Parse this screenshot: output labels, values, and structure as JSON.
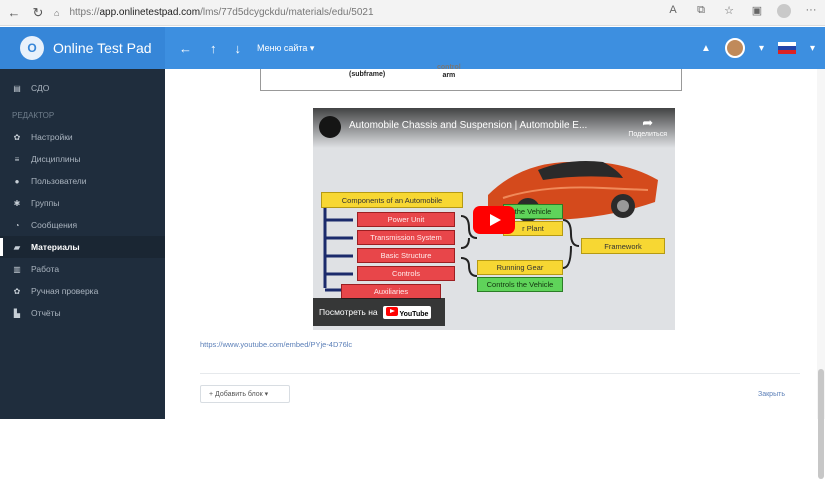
{
  "browser": {
    "url_prefix": "https://",
    "url_host": "app.onlinetestpad.com",
    "url_path": "/lms/77d5dcygckdu/materials/edu/5021",
    "back_icon": "back-arrow-icon",
    "reload_icon": "reload-icon"
  },
  "header": {
    "brand": "Online Test Pad",
    "menu_label": "Меню сайта ▾",
    "accent": "#3d8fe0"
  },
  "sidebar": {
    "top_item": "СДО",
    "section_title": "РЕДАКТОР",
    "items": [
      {
        "label": "Настройки",
        "icon": "gear-icon"
      },
      {
        "label": "Дисциплины",
        "icon": "book-icon"
      },
      {
        "label": "Пользователи",
        "icon": "user-icon"
      },
      {
        "label": "Группы",
        "icon": "users-icon"
      },
      {
        "label": "Сообщения",
        "icon": "chat-icon"
      },
      {
        "label": "Материалы",
        "icon": "folder-icon",
        "active": true
      },
      {
        "label": "Работа",
        "icon": "bank-icon"
      },
      {
        "label": "Ручная проверка",
        "icon": "check-icon"
      },
      {
        "label": "Отчёты",
        "icon": "chart-icon"
      }
    ]
  },
  "table_fragment": {
    "cell1": "(subframe)",
    "cell2a": "control",
    "cell2b": "arm"
  },
  "video": {
    "title": "Automobile Chassis and Suspension | Automobile E...",
    "share": "Поделиться",
    "watch_on": "Посмотреть на",
    "youtube": "YouTube",
    "diagram": {
      "components": "Components of an Automobile",
      "power_unit": "Power Unit",
      "transmission": "Transmission System",
      "basic_structure": "Basic Structure",
      "controls": "Controls",
      "auxiliaries": "Auxiliaries",
      "the_vehicle": "the Vehicle",
      "power_plant": "r Plant",
      "framework": "Framework",
      "running_gear": "Running Gear",
      "controls_vehicle": "Controls the Vehicle"
    }
  },
  "link_text": "https://www.youtube.com/embed/PYje-4D76lc",
  "footer": {
    "add_block": "+ Добавить блок ▾",
    "close": "Закрыть"
  }
}
